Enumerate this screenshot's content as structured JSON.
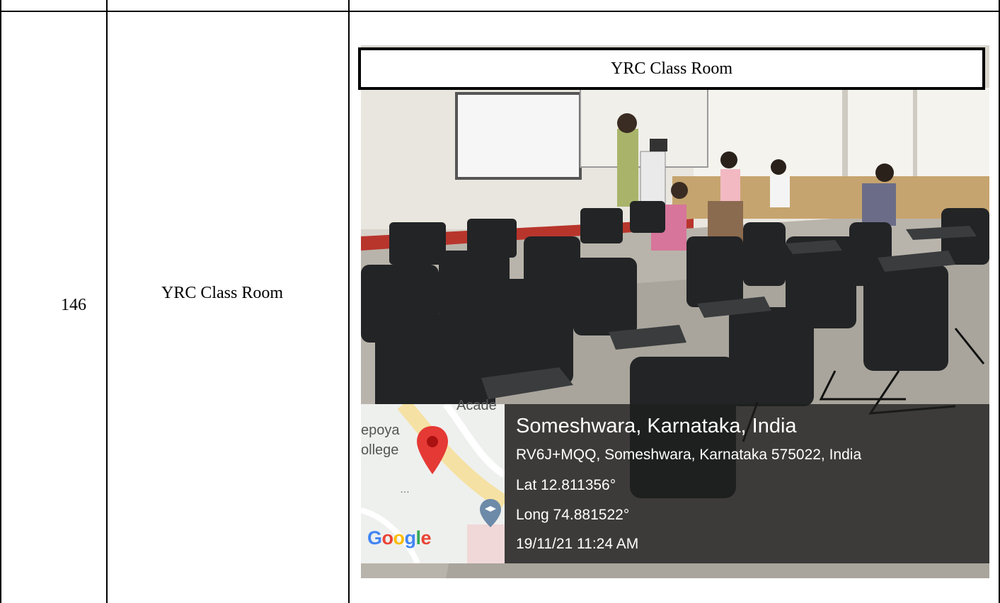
{
  "row": {
    "number": "146",
    "name": "YRC Class Room"
  },
  "photo": {
    "caption": "YRC Class Room",
    "geotag": {
      "place": "Someshwara, Karnataka, India",
      "address": "RV6J+MQQ, Someshwara, Karnataka 575022, India",
      "lat": "Lat 12.811356°",
      "long": "Long 74.881522°",
      "datetime": "19/11/21 11:24 AM"
    },
    "map": {
      "label_1": "epoya",
      "label_2": "ollege",
      "label_3": "Acade",
      "brand": "Google"
    }
  }
}
